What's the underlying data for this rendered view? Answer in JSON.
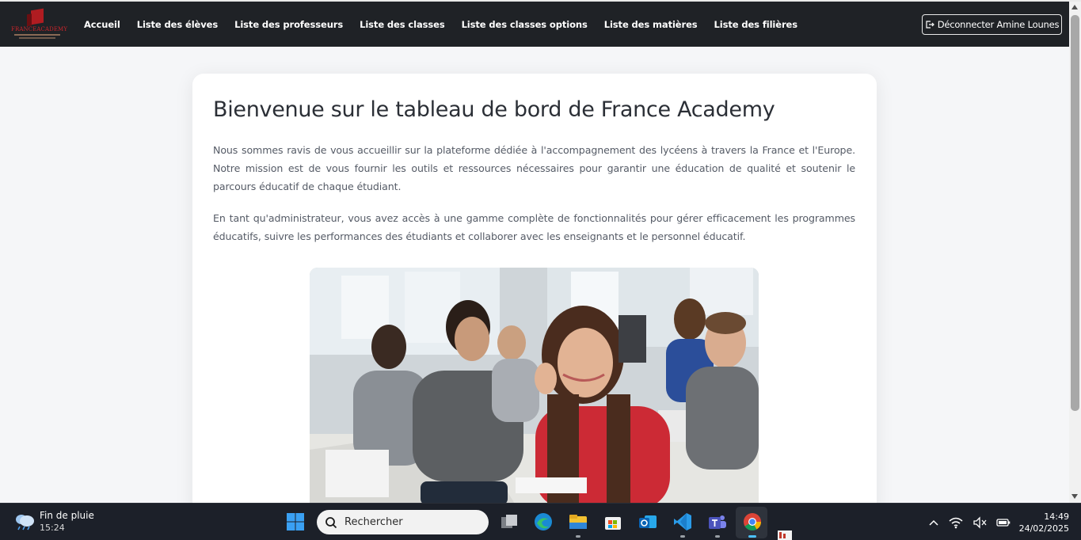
{
  "navbar": {
    "logo_text": "FRANCEACADEMY",
    "links": [
      {
        "label": "Accueil"
      },
      {
        "label": "Liste des élèves"
      },
      {
        "label": "Liste des professeurs"
      },
      {
        "label": "Liste des classes"
      },
      {
        "label": "Liste des classes options"
      },
      {
        "label": "Liste des matières"
      },
      {
        "label": "Liste des filières"
      }
    ],
    "logout_label": "Déconnecter Amine Lounes"
  },
  "main": {
    "title": "Bienvenue sur le tableau de bord de France Academy",
    "paragraph1": "Nous sommes ravis de vous accueillir sur la plateforme dédiée à l'accompagnement des lycéens à travers la France et l'Europe. Notre mission est de vous fournir les outils et ressources nécessaires pour garantir une éducation de qualité et soutenir le parcours éducatif de chaque étudiant.",
    "paragraph2": "En tant qu'administrateur, vous avez accès à une gamme complète de fonctionnalités pour gérer efficacement les programmes éducatifs, suivre les performances des étudiants et collaborer avec les enseignants et le personnel éducatif.",
    "image_icon": "classroom-students-photo"
  },
  "taskbar": {
    "weather": {
      "condition": "Fin de pluie",
      "time": "15:24",
      "icon": "rain-cloud-icon"
    },
    "search_placeholder": "Rechercher",
    "apps": [
      "task-view-icon",
      "edge-icon",
      "file-explorer-icon",
      "store-icon",
      "outlook-icon",
      "vscode-icon",
      "teams-icon",
      "chrome-icon"
    ],
    "tray_icons": [
      "chevron-up-icon",
      "wifi-icon",
      "speaker-muted-icon",
      "battery-icon"
    ],
    "clock": {
      "time": "14:49",
      "date": "24/02/2025"
    }
  },
  "colors": {
    "navbar_bg": "#1f2226",
    "page_bg": "#f5f6f8",
    "card_bg": "#ffffff",
    "taskbar_bg": "#1c2029",
    "logo_red": "#b01c21"
  }
}
